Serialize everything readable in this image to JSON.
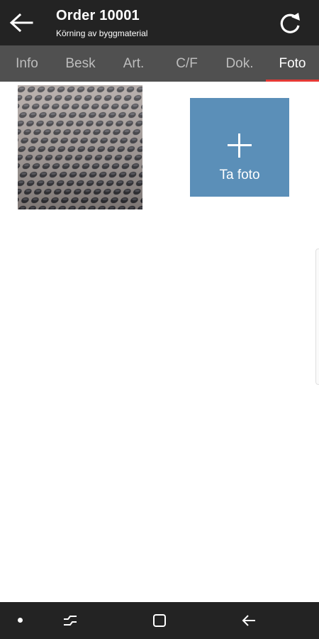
{
  "header": {
    "title": "Order 10001",
    "subtitle": "Körning av byggmaterial",
    "back_icon": "arrow-left-icon",
    "refresh_icon": "refresh-icon"
  },
  "tabs": [
    {
      "label": "Info",
      "active": false
    },
    {
      "label": "Besk",
      "active": false
    },
    {
      "label": "Art.",
      "active": false
    },
    {
      "label": "C/F",
      "active": false
    },
    {
      "label": "Dok.",
      "active": false
    },
    {
      "label": "Foto",
      "active": true
    }
  ],
  "photos": {
    "take_photo_label": "Ta foto",
    "add_icon": "plus-icon"
  },
  "nav": {
    "icons": [
      "dot-icon",
      "recent-apps-icon",
      "home-icon",
      "back-icon"
    ]
  },
  "colors": {
    "header_bg": "#232323",
    "tab_bar_bg": "#505050",
    "active_tab_indicator": "#e53935",
    "take_photo_bg": "#5b8fb8"
  }
}
